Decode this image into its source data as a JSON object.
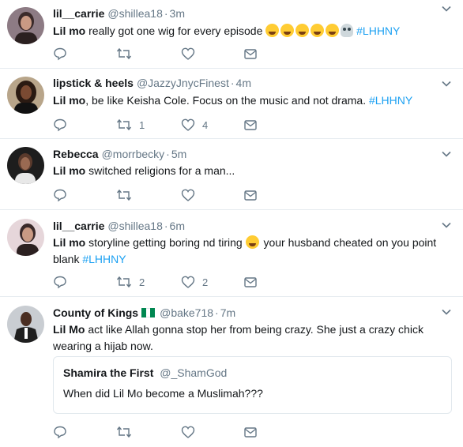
{
  "tweets": [
    {
      "name": "lil__carrie",
      "handle": "@shillea18",
      "separator": "·",
      "time": "3m",
      "text": {
        "bold": "Lil mo",
        "rest": " really got one wig for every episode ",
        "hashtag": "#LHHNY"
      },
      "emojis": [
        "laughing-tears",
        "laughing-tears",
        "laughing-tears",
        "laughing-tears",
        "laughing-tears",
        "skull"
      ],
      "reply_count": "",
      "retweet_count": "",
      "like_count": ""
    },
    {
      "name": "lipstick & heels",
      "handle": "@JazzyJnycFinest",
      "separator": "·",
      "time": "4m",
      "text": {
        "bold": "Lil mo",
        "rest": ",  be like Keisha Cole.  Focus on the music and not drama. ",
        "hashtag": "#LHHNY"
      },
      "reply_count": "",
      "retweet_count": "1",
      "like_count": "4"
    },
    {
      "name": "Rebecca",
      "handle": "@morrbecky",
      "separator": "·",
      "time": "5m",
      "text": {
        "bold": "Lil mo",
        "rest": " switched religions for a man...",
        "hashtag": ""
      },
      "reply_count": "",
      "retweet_count": "",
      "like_count": ""
    },
    {
      "name": "lil__carrie",
      "handle": "@shillea18",
      "separator": "·",
      "time": "6m",
      "text": {
        "bold": "Lil mo",
        "rest": " storyline getting boring nd tiring ",
        "rest2": " your husband cheated on you point blank ",
        "hashtag": "#LHHNY"
      },
      "emojis": [
        "sleeping-face"
      ],
      "reply_count": "",
      "retweet_count": "2",
      "like_count": "2"
    },
    {
      "name": "County of Kings",
      "handle": "@bake718",
      "separator": "·",
      "time": "7m",
      "flag": "nigeria-flag",
      "text": {
        "bold": "Lil Mo",
        "rest": " act like Allah gonna stop her from being crazy. She just a crazy chick wearing a hijab now.",
        "hashtag": ""
      },
      "quote": {
        "name": "Shamira the First",
        "handle": "@_ShamGod",
        "text": "When did Lil Mo become  a Muslimah???"
      },
      "reply_count": "",
      "retweet_count": "",
      "like_count": ""
    }
  ],
  "icons": {
    "reply": "reply-icon",
    "retweet": "retweet-icon",
    "like": "like-icon",
    "message": "message-icon",
    "more": "chevron-down-icon"
  },
  "colors": {
    "link": "#1da1f2",
    "secondary_text": "#657786",
    "divider": "#e6ecf0",
    "flag_green": "#008751"
  }
}
